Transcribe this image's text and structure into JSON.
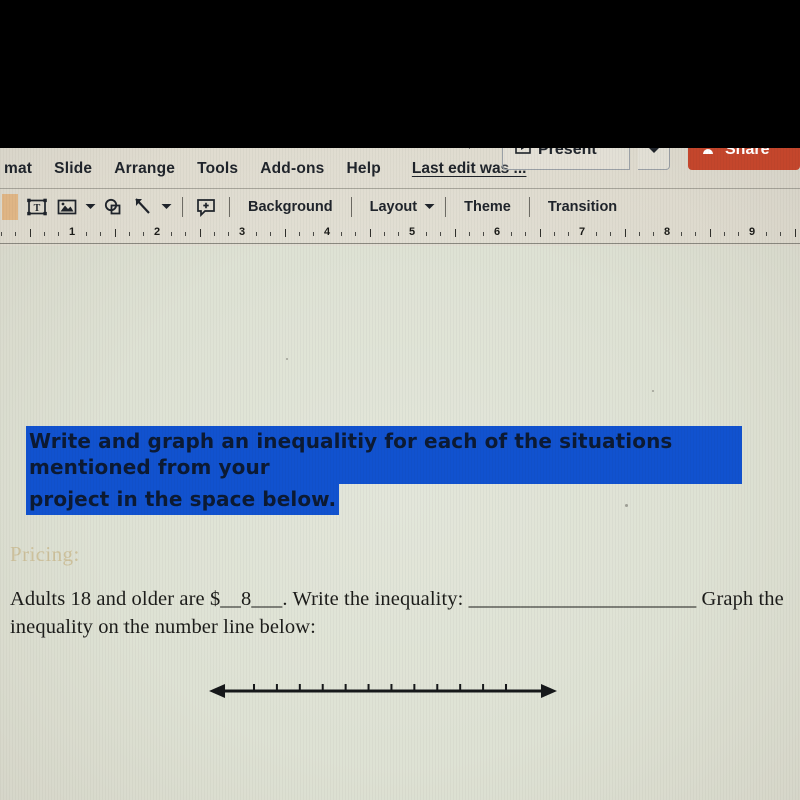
{
  "app": {
    "name": "Google Slides",
    "menus": [
      {
        "label": "mat",
        "name": "format"
      },
      {
        "label": "Slide",
        "name": "slide"
      },
      {
        "label": "Arrange",
        "name": "arrange"
      },
      {
        "label": "Tools",
        "name": "tools"
      },
      {
        "label": "Add-ons",
        "name": "add-ons"
      },
      {
        "label": "Help",
        "name": "help"
      }
    ],
    "last_edit": "Last edit was ...",
    "present_label": "Present",
    "share_label": "Share",
    "share_color": "#c4462c"
  },
  "toolbar": {
    "items": [
      {
        "label": "Background",
        "name": "background"
      },
      {
        "label": "Layout",
        "name": "layout",
        "caret": true
      },
      {
        "label": "Theme",
        "name": "theme"
      },
      {
        "label": "Transition",
        "name": "transition"
      }
    ],
    "icons": [
      {
        "name": "text-box-icon"
      },
      {
        "name": "image-icon"
      },
      {
        "name": "shape-icon"
      },
      {
        "name": "line-icon"
      },
      {
        "name": "comment-icon"
      }
    ]
  },
  "ruler": {
    "numbers": [
      "1",
      "2",
      "3",
      "4",
      "5",
      "6",
      "7",
      "8",
      "9"
    ]
  },
  "slide": {
    "title": {
      "line1": "Write and graph an inequalitiy for each of the situations mentioned from your",
      "line2": "project in the space below.",
      "highlight_color": "#1152cf",
      "text_color": "#0c1a33"
    },
    "pricing_heading": "Pricing:",
    "body": {
      "part1": "Adults 18 and older are $__8___. Write the inequality: ",
      "blank": "______________________",
      "part2": " Graph the",
      "line2": "inequality on the number line below:"
    },
    "number_line": {
      "name": "number-line",
      "tick_count": 12,
      "left_arrow": true,
      "right_arrow": true
    },
    "background_color": "#dee2d4"
  }
}
